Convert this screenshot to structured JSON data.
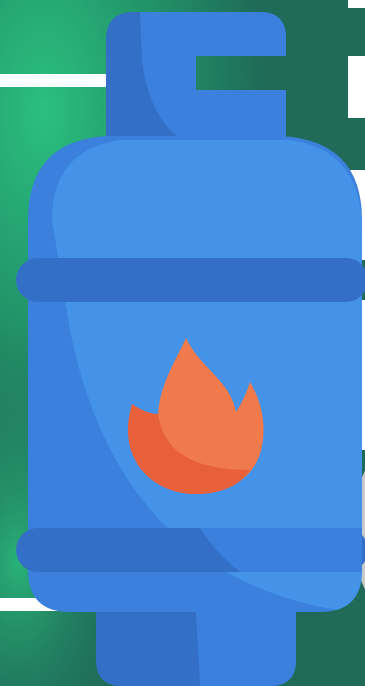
{
  "colors": {
    "background_dark_green": "#1f6b57",
    "background_light_green": "#2bbf7f",
    "stripe_white": "#ffffff",
    "cylinder_blue": "#4493e8",
    "cylinder_dark_blue": "#346fc7",
    "cylinder_highlight_blue": "#3a80dc",
    "flame_outer": "#f07a4c",
    "flame_inner": "#e8603a",
    "side_grey": "#c9c9c9"
  },
  "icons": {
    "main": "gas-cylinder-icon",
    "flame": "flame-icon"
  }
}
